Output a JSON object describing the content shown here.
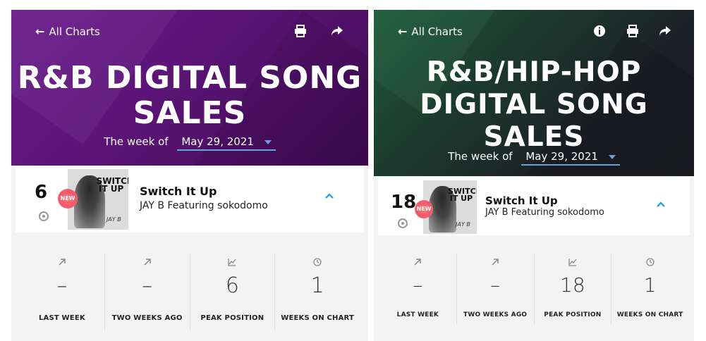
{
  "panels": [
    {
      "back_label": "All Charts",
      "back_icon": "arrow-left-icon",
      "tools": [
        "print-icon",
        "share-icon"
      ],
      "title_lines": [
        "R&B DIGITAL SONG",
        "SALES"
      ],
      "week_prefix": "The week of",
      "week_value": "May 29, 2021",
      "accent_color": "#5b1476",
      "entry": {
        "rank": "6",
        "badge": "NEW",
        "cover_text": "SWITCH IT UP",
        "cover_sig": "JAY B",
        "title": "Switch It Up",
        "artist": "JAY B Featuring sokodomo"
      },
      "stats": [
        {
          "icon": "arrow-up-right-icon",
          "value": "–",
          "label": "LAST WEEK"
        },
        {
          "icon": "arrow-up-right-icon",
          "value": "–",
          "label": "TWO WEEKS AGO"
        },
        {
          "icon": "trend-chart-icon",
          "value": "6",
          "label": "PEAK POSITION"
        },
        {
          "icon": "clock-icon",
          "value": "1",
          "label": "WEEKS ON CHART"
        }
      ]
    },
    {
      "back_label": "All Charts",
      "back_icon": "arrow-left-icon",
      "tools": [
        "info-icon",
        "print-icon",
        "share-icon"
      ],
      "title_lines": [
        "R&B/HIP-HOP",
        "DIGITAL SONG",
        "SALES"
      ],
      "week_prefix": "The week of",
      "week_value": "May 29, 2021",
      "accent_color": "#1c3b2f",
      "entry": {
        "rank": "18",
        "badge": "NEW",
        "cover_text": "SWITCH IT UP",
        "cover_sig": "JAY B",
        "title": "Switch It Up",
        "artist": "JAY B Featuring sokodomo"
      },
      "stats": [
        {
          "icon": "arrow-up-right-icon",
          "value": "–",
          "label": "LAST WEEK"
        },
        {
          "icon": "arrow-up-right-icon",
          "value": "–",
          "label": "TWO WEEKS AGO"
        },
        {
          "icon": "trend-chart-icon",
          "value": "18",
          "label": "PEAK POSITION"
        },
        {
          "icon": "clock-icon",
          "value": "1",
          "label": "WEEKS ON CHART"
        }
      ]
    }
  ]
}
